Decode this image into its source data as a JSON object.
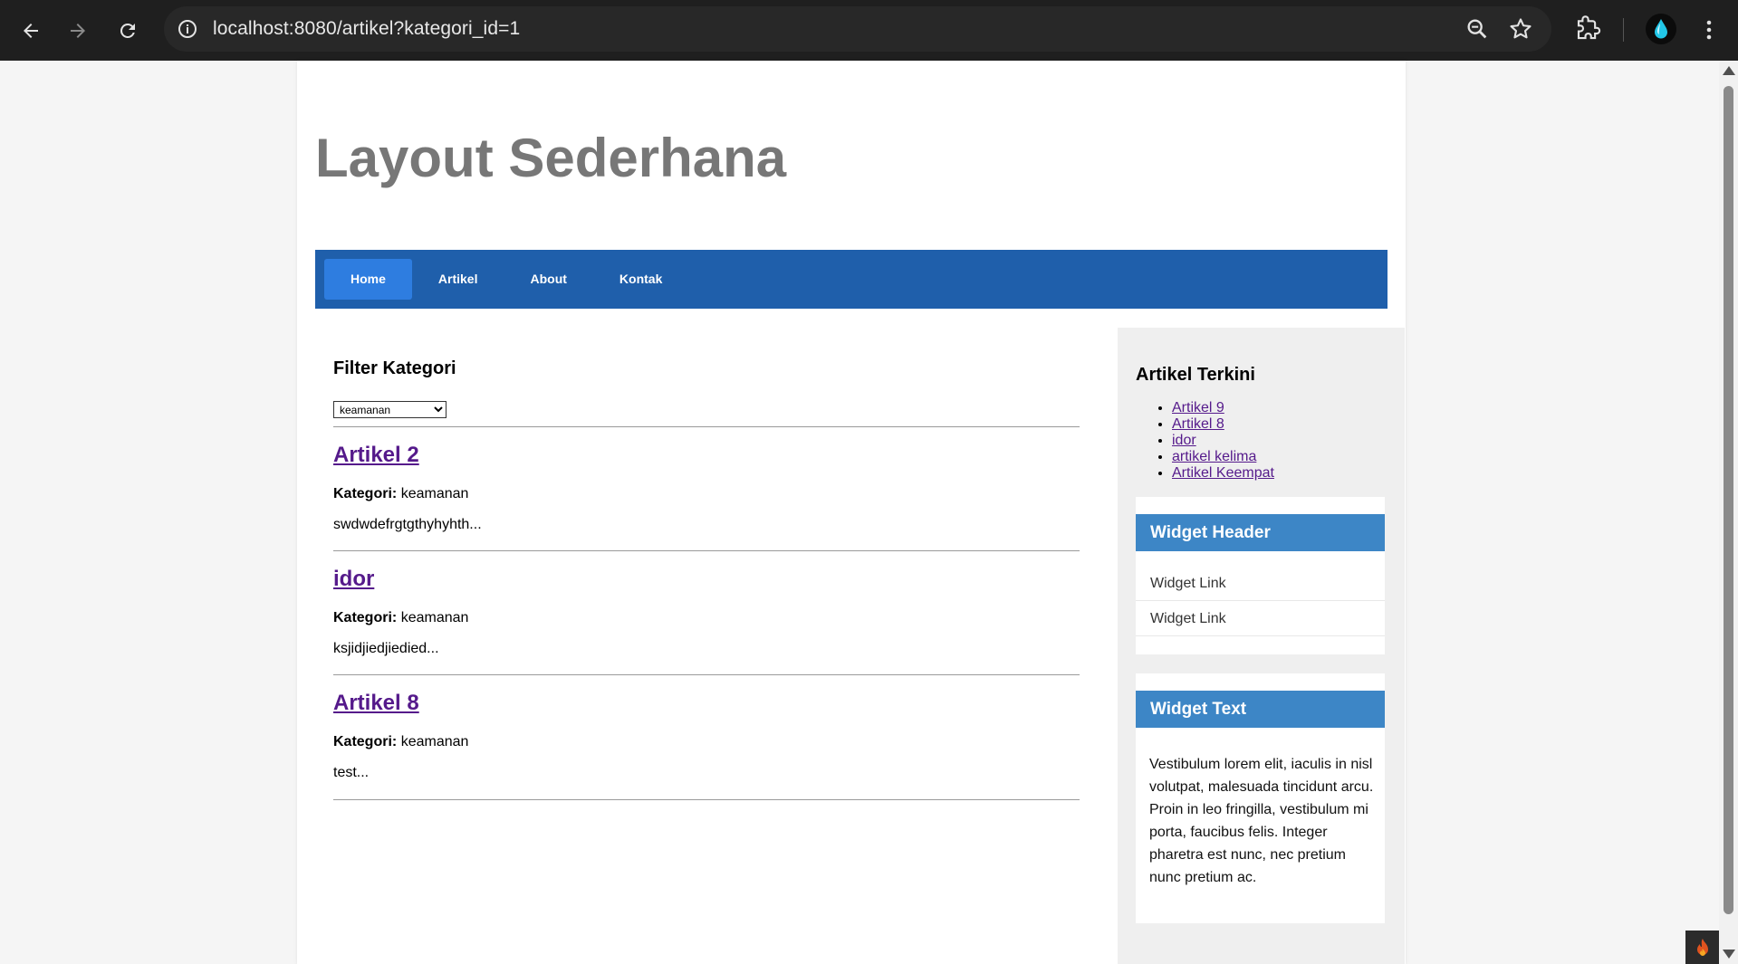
{
  "browser": {
    "url": "localhost:8080/artikel?kategori_id=1"
  },
  "site": {
    "title": "Layout Sederhana",
    "nav": [
      {
        "label": "Home",
        "active": true
      },
      {
        "label": "Artikel",
        "active": false
      },
      {
        "label": "About",
        "active": false
      },
      {
        "label": "Kontak",
        "active": false
      }
    ]
  },
  "main": {
    "filter_title": "Filter Kategori",
    "filter_selected": "keamanan",
    "category_label": "Kategori:",
    "articles": [
      {
        "title": "Artikel 2",
        "category": "keamanan",
        "excerpt": "swdwdefrgtgthyhyhth..."
      },
      {
        "title": "idor",
        "category": "keamanan",
        "excerpt": "ksjidjiedjiedied..."
      },
      {
        "title": "Artikel 8",
        "category": "keamanan",
        "excerpt": "test..."
      }
    ]
  },
  "sidebar": {
    "recent_title": "Artikel Terkini",
    "recent": [
      "Artikel 9",
      "Artikel 8",
      "idor",
      "artikel kelima",
      "Artikel Keempat"
    ],
    "widget1": {
      "header": "Widget Header",
      "links": [
        "Widget Link",
        "Widget Link"
      ]
    },
    "widget2": {
      "header": "Widget Text",
      "text": "Vestibulum lorem elit, iaculis in nisl volutpat, malesuada tincidunt arcu. Proin in leo fringilla, vestibulum mi porta, faucibus felis. Integer pharetra est nunc, nec pretium nunc pretium ac."
    }
  },
  "colors": {
    "navbar": "#1f5fab",
    "nav_active": "#2e7de0",
    "widget_header": "#3d86c6",
    "visited_link": "#551a8b"
  }
}
